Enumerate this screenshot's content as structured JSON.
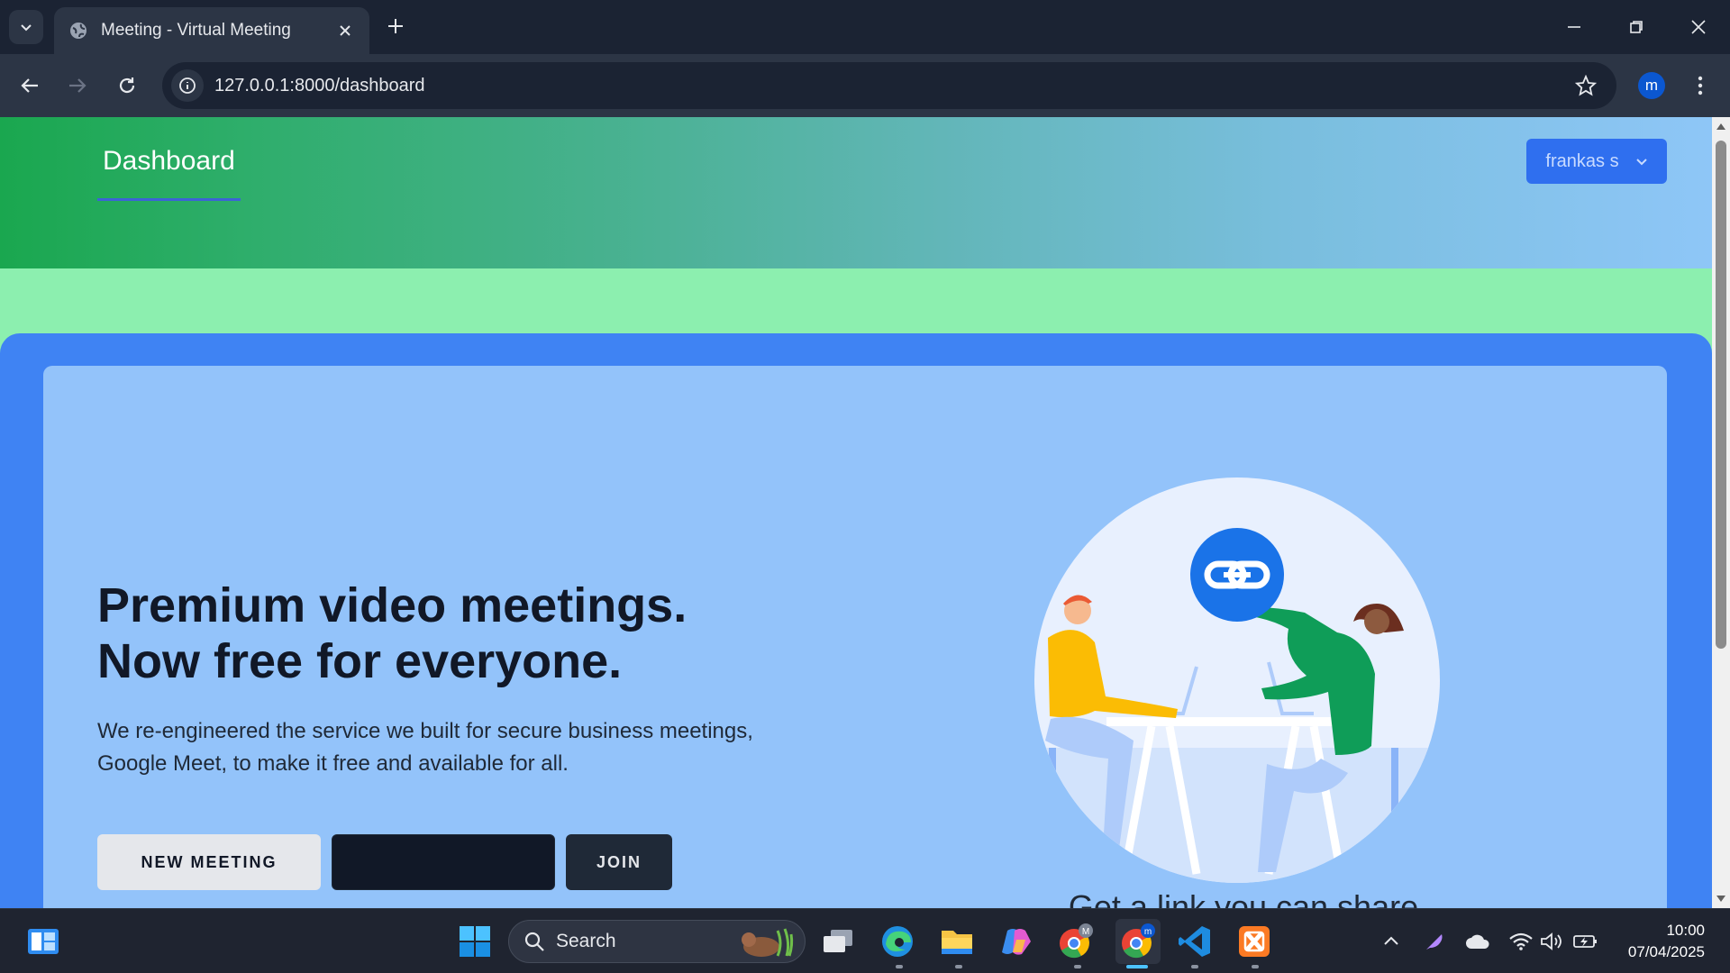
{
  "browser": {
    "tab_title": "Meeting - Virtual Meeting",
    "url": "127.0.0.1:8000/dashboard",
    "profile_initial": "m"
  },
  "page": {
    "nav": {
      "dashboard_label": "Dashboard"
    },
    "user_menu": {
      "label": "frankas s"
    },
    "hero": {
      "title_line1": "Premium video meetings.",
      "title_line2": "Now free for everyone.",
      "description_line1": "We re-engineered the service we built for secure business meetings,",
      "description_line2": "Google Meet, to make it free and available for all.",
      "new_meeting_label": "NEW MEETING",
      "meeting_code_value": "",
      "join_label": "JOIN"
    },
    "illustration_caption": "Get a link you can share"
  },
  "taskbar": {
    "search_label": "Search",
    "time": "10:00",
    "date": "07/04/2025"
  },
  "colors": {
    "header_gradient_start": "#1aa74f",
    "header_gradient_end": "#8ec6f7",
    "band_green": "#8cefaf",
    "panel_blue": "#3f83f3",
    "card_blue": "#93c3fa",
    "user_button": "#2f6fef"
  }
}
